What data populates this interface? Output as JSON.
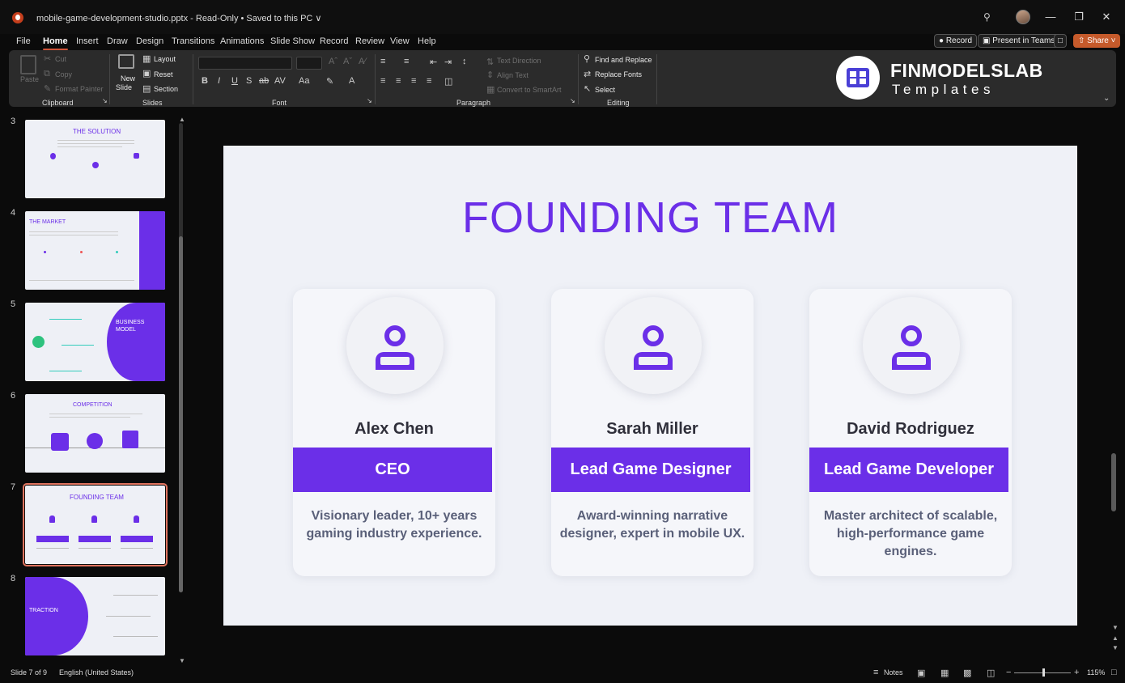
{
  "window": {
    "title": "mobile-game-development-studio.pptx  -  Read-Only  •  Saved to this PC ∨",
    "controls": {
      "minimize": "—",
      "restore": "❐",
      "close": "✕"
    }
  },
  "menu": {
    "tabs": [
      "File",
      "Home",
      "Insert",
      "Draw",
      "Design",
      "Transitions",
      "Animations",
      "Slide Show",
      "Record",
      "Review",
      "View",
      "Help"
    ],
    "active": "Home",
    "record_button": "Record",
    "teams_button": "Present in Teams",
    "share_button": "Share"
  },
  "ribbon": {
    "clipboard": {
      "paste": "Paste",
      "cut": "Cut",
      "copy": "Copy",
      "format_painter": "Format Painter",
      "label": "Clipboard"
    },
    "slides": {
      "new_slide_1": "New",
      "new_slide_2": "Slide",
      "layout": "Layout",
      "reset": "Reset",
      "section": "Section",
      "label": "Slides"
    },
    "font": {
      "label": "Font"
    },
    "paragraph": {
      "text_direction": "Text Direction",
      "align_text": "Align Text",
      "convert_smartart": "Convert to SmartArt",
      "label": "Paragraph"
    },
    "editing": {
      "find_replace": "Find and Replace",
      "replace_fonts": "Replace Fonts",
      "select": "Select",
      "label": "Editing"
    }
  },
  "brand": {
    "name": "FINMODELSLAB",
    "subtitle": "Templates"
  },
  "thumbnails": {
    "numbers": [
      "3",
      "4",
      "5",
      "6",
      "7",
      "8"
    ],
    "solution_title": "THE SOLUTION",
    "market_title": "THE MARKET",
    "business_title_1": "BUSINESS",
    "business_title_2": "MODEL",
    "competition_title": "COMPETITION",
    "founding_title": "FOUNDING TEAM",
    "traction_title": "TRACTION"
  },
  "slide": {
    "title": "FOUNDING TEAM",
    "members": [
      {
        "name": "Alex Chen",
        "role": "CEO",
        "desc_line1": "Visionary leader, 10+ years",
        "desc_line2": "gaming industry experience."
      },
      {
        "name": "Sarah Miller",
        "role": "Lead Game Designer",
        "desc_line1": "Award-winning narrative",
        "desc_line2": "designer, expert in mobile UX."
      },
      {
        "name": "David Rodriguez",
        "role": "Lead Game Developer",
        "desc_line1": "Master architect of scalable,",
        "desc_line2": "high-performance game engines."
      }
    ],
    "accent_color": "#6b2fe8"
  },
  "status": {
    "slide_counter": "Slide 7 of 9",
    "language": "English (United States)",
    "notes": "Notes",
    "zoom": "115%"
  }
}
